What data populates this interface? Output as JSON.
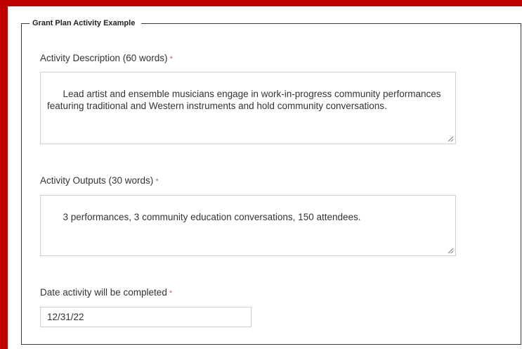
{
  "fieldset": {
    "legend": "Grant Plan Activity Example"
  },
  "fields": {
    "description": {
      "label": "Activity Description (60 words)",
      "required_mark": "*",
      "value": "Lead artist and ensemble musicians engage in work-in-progress community performances featuring traditional and Western instruments and hold community conversations."
    },
    "outputs": {
      "label": "Activity Outputs (30 words)",
      "required_mark": "*",
      "value": "3 performances, 3 community education conversations, 150 attendees."
    },
    "completion_date": {
      "label": "Date activity will be completed",
      "required_mark": "*",
      "value": "12/31/22"
    }
  },
  "colors": {
    "frame_border": "#c00000",
    "required_mark": "#d9534f"
  }
}
